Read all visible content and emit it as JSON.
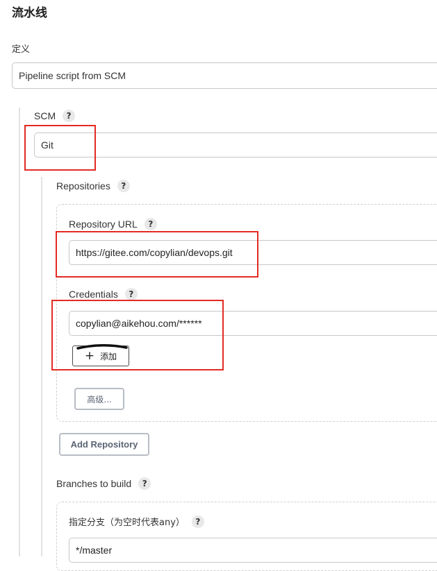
{
  "section": {
    "title": "流水线"
  },
  "definition": {
    "label": "定义",
    "value": "Pipeline script from SCM"
  },
  "scm": {
    "label": "SCM",
    "help": "?",
    "value": "Git"
  },
  "repositories": {
    "label": "Repositories",
    "help": "?",
    "url_label": "Repository URL",
    "url_help": "?",
    "url_value": "https://gitee.com/copylian/devops.git",
    "credentials_label": "Credentials",
    "credentials_help": "?",
    "credentials_value": "copylian@aikehou.com/******",
    "add_icon": "plus-icon",
    "add_label": "添加",
    "advanced_label": "高级...",
    "add_repository_label": "Add Repository"
  },
  "branches": {
    "label": "Branches to build",
    "help": "?",
    "specifier_label": "指定分支（为空时代表any）",
    "specifier_help": "?",
    "specifier_value": "*/master"
  },
  "colors": {
    "highlight": "#e32a22",
    "border": "#c7c7cc",
    "help_bg": "#e8e8e8"
  }
}
